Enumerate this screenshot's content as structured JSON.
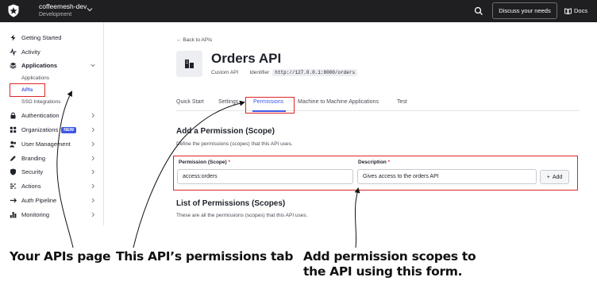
{
  "topbar": {
    "tenant_name": "coffeemesh-dev",
    "tenant_env": "Development",
    "discuss_label": "Discuss your needs",
    "docs_label": "Docs"
  },
  "sidebar": {
    "items": [
      {
        "label": "Getting Started",
        "icon": "lightning-icon"
      },
      {
        "label": "Activity",
        "icon": "activity-icon"
      },
      {
        "label": "Applications",
        "icon": "stack-icon"
      },
      {
        "label": "Authentication",
        "icon": "lock-icon"
      },
      {
        "label": "Organizations",
        "icon": "grid-icon",
        "badge": "NEW"
      },
      {
        "label": "User Management",
        "icon": "users-icon"
      },
      {
        "label": "Branding",
        "icon": "pen-icon"
      },
      {
        "label": "Security",
        "icon": "shield-icon"
      },
      {
        "label": "Actions",
        "icon": "actions-icon"
      },
      {
        "label": "Auth Pipeline",
        "icon": "pipeline-icon"
      },
      {
        "label": "Monitoring",
        "icon": "bar-chart-icon"
      }
    ],
    "applications_sub": [
      "Applications",
      "APIs",
      "SSO Integrations"
    ]
  },
  "main": {
    "back_label": "Back to APIs",
    "api_name": "Orders API",
    "api_type": "Custom API",
    "identifier_label": "Identifier",
    "identifier_value": "http://127.0.0.1:8000/orders",
    "tabs": [
      "Quick Start",
      "Settings",
      "Permissions",
      "Machine to Machine Applications",
      "Test"
    ],
    "active_tab": "Permissions",
    "add_section": {
      "title": "Add a Permission (Scope)",
      "description": "Define the permissions (scopes) that this API uses.",
      "permission_label": "Permission (Scope)",
      "permission_value": "access:orders",
      "description_label": "Description",
      "description_value": "Gives access to the orders API",
      "required_mark": "*",
      "add_button": "Add"
    },
    "list_section": {
      "title": "List of Permissions (Scopes)",
      "description": "These are all the permissions (scopes) that this API uses."
    }
  },
  "annotations": {
    "apis_page": "Your APIs page",
    "permissions_tab": "This API’s permissions tab",
    "form_line1": "Add permission scopes to",
    "form_line2": "the API using this form."
  },
  "colors": {
    "accent": "#3f59e4",
    "highlight": "#e02424",
    "topbar": "#1f1f21"
  }
}
